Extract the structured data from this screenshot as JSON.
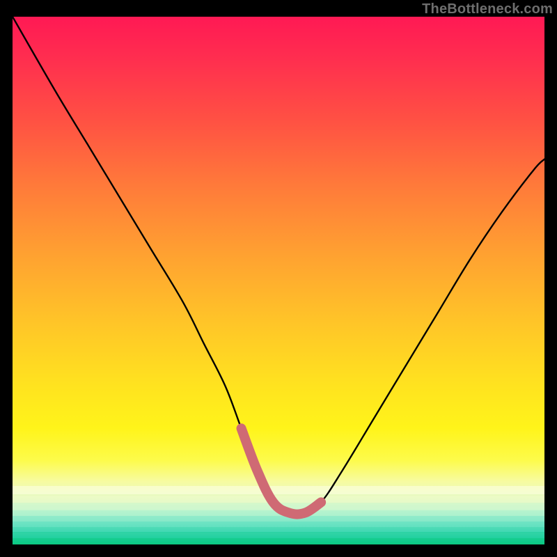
{
  "watermark": "TheBottleneck.com",
  "chart_data": {
    "type": "line",
    "title": "",
    "xlabel": "",
    "ylabel": "",
    "xlim": [
      0,
      100
    ],
    "ylim": [
      0,
      100
    ],
    "grid": false,
    "legend": false,
    "series": [
      {
        "name": "bottleneck-curve",
        "color": "#000000",
        "x": [
          0,
          8,
          14,
          20,
          26,
          32,
          36,
          40,
          43,
          46,
          49,
          52,
          55,
          58,
          62,
          68,
          74,
          80,
          86,
          92,
          98,
          100
        ],
        "values": [
          100,
          86,
          76,
          66,
          56,
          46,
          38,
          30,
          22,
          14,
          8,
          6,
          6,
          8,
          14,
          24,
          34,
          44,
          54,
          63,
          71,
          73
        ]
      },
      {
        "name": "valley-highlight",
        "color": "#cf6a74",
        "x": [
          43,
          46,
          49,
          52,
          55,
          58
        ],
        "values": [
          22,
          14,
          8,
          6,
          6,
          8
        ]
      }
    ],
    "background": {
      "type": "vertical-gradient",
      "stops": [
        {
          "pos": 0.0,
          "color": "#ff1954"
        },
        {
          "pos": 0.45,
          "color": "#ffa131"
        },
        {
          "pos": 0.78,
          "color": "#fff41a"
        },
        {
          "pos": 0.93,
          "color": "#c7f6cf"
        },
        {
          "pos": 1.0,
          "color": "#0ccb86"
        }
      ]
    }
  }
}
